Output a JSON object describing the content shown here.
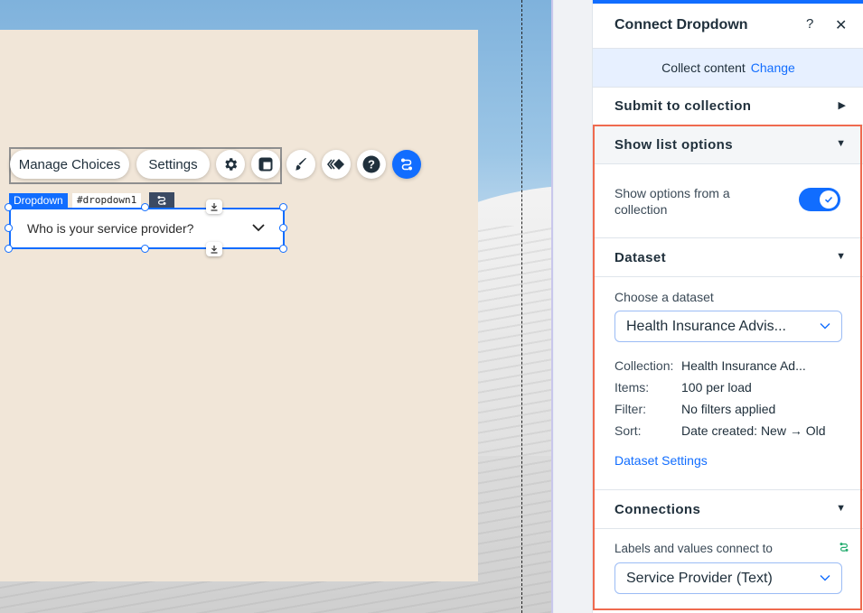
{
  "toolbar": {
    "manage_choices": "Manage Choices",
    "settings": "Settings",
    "icons": [
      "gear-icon",
      "layout-icon",
      "brush-icon",
      "animation-icon",
      "help-icon",
      "connect-data-icon"
    ]
  },
  "element": {
    "type_label": "Dropdown",
    "id_label": "#dropdown1",
    "placeholder": "Who is your service provider?"
  },
  "panel": {
    "title": "Connect Dropdown",
    "help": "?",
    "close": "✕",
    "collect": {
      "text": "Collect content",
      "change": "Change"
    },
    "submit_section": "Submit to collection",
    "show_list_section": "Show list options",
    "show_options_label": "Show options from a collection",
    "show_options_enabled": true,
    "dataset_section": "Dataset",
    "choose_dataset_label": "Choose a dataset",
    "dataset_value": "Health Insurance Advis...",
    "details": [
      {
        "label": "Collection:",
        "value": "Health Insurance Ad..."
      },
      {
        "label": "Items:",
        "value": "100 per load"
      },
      {
        "label": "Filter:",
        "value": "No filters applied"
      },
      {
        "label": "Sort:",
        "value": "Date created: New → Old"
      }
    ],
    "dataset_settings_link": "Dataset Settings",
    "connections_section": "Connections",
    "labels_values_label": "Labels and values connect to",
    "labels_values_value": "Service Provider (Text)"
  },
  "colors": {
    "accent": "#116dff",
    "highlight_border": "#ef6a4f",
    "section_bg": "#f1e6d8"
  }
}
